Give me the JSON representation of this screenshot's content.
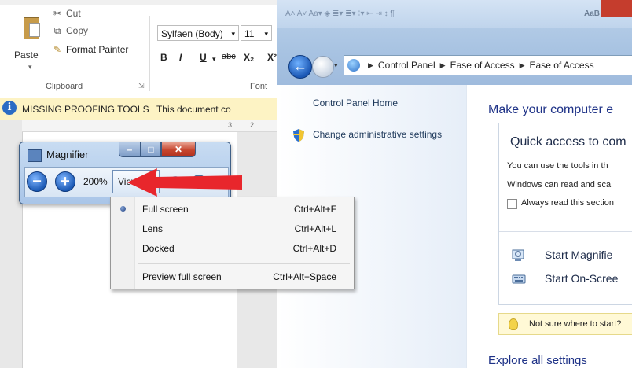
{
  "word": {
    "clipboard": {
      "paste_label": "Paste",
      "cut_label": "Cut",
      "copy_label": "Copy",
      "format_painter_label": "Format Painter",
      "group_label": "Clipboard"
    },
    "font": {
      "font_name": "Sylfaen (Body)",
      "font_size": "11",
      "bold": "B",
      "italic": "I",
      "underline": "U",
      "strike": "abc",
      "subscript": "X₂",
      "superscript": "X²",
      "group_label": "Font"
    },
    "message_bar": {
      "title": "MISSING PROOFING TOOLS",
      "text": "This document co"
    },
    "ruler": [
      "3",
      "2"
    ]
  },
  "control_panel": {
    "breadcrumb": [
      "Control Panel",
      "Ease of Access",
      "Ease of Access"
    ],
    "sidebar": {
      "home_link": "Control Panel Home",
      "admin_link": "Change administrative settings"
    },
    "heading": "Make your computer e",
    "quick_access": {
      "title": "Quick access to com",
      "line1": "You can use the tools in th",
      "line2": "Windows can read and sca",
      "checkbox_label": "Always read this section",
      "tools": [
        "Start Magnifie",
        "Start On-Scree"
      ]
    },
    "tip": "Not sure where to start?",
    "explore": "Explore all settings"
  },
  "magnifier": {
    "title": "Magnifier",
    "zoom_level": "200%",
    "views_label": "Views"
  },
  "views_menu": {
    "items": [
      {
        "label": "Full screen",
        "shortcut": "Ctrl+Alt+F",
        "selected": true
      },
      {
        "label": "Lens",
        "shortcut": "Ctrl+Alt+L",
        "selected": false
      },
      {
        "label": "Docked",
        "shortcut": "Ctrl+Alt+D",
        "selected": false
      },
      {
        "label": "Preview full screen",
        "shortcut": "Ctrl+Alt+Space",
        "selected": false
      }
    ]
  },
  "colors": {
    "arrow": "#e8262c",
    "link": "#1e395b",
    "heading": "#1e3287"
  }
}
